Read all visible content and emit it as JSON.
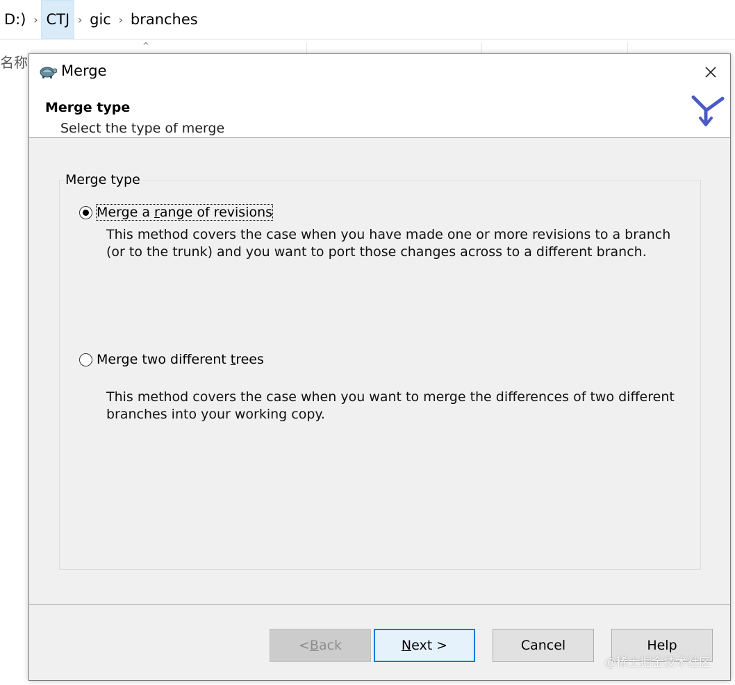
{
  "explorer": {
    "breadcrumb": [
      {
        "label": "D:)"
      },
      {
        "label": "CTJ"
      },
      {
        "label": "gic"
      },
      {
        "label": "branches"
      }
    ],
    "name_column": "名称"
  },
  "dialog": {
    "title": "Merge",
    "header_title": "Merge type",
    "header_subtitle": "Select the type of merge",
    "group_title": "Merge type",
    "options": [
      {
        "pre": "Merge a ",
        "mnemonic": "r",
        "post": "ange of revisions",
        "selected": true,
        "description": [
          "This method covers the case when you have made one or more revisions to a branch",
          "(or to the trunk) and you want to port those changes across to a different branch."
        ]
      },
      {
        "pre": "Merge two different ",
        "mnemonic": "t",
        "post": "rees",
        "selected": false,
        "description": [
          "This method covers the case when you want to merge the differences of two different",
          "branches into your working copy."
        ]
      }
    ],
    "buttons": {
      "back": {
        "pre": "< ",
        "mnemonic": "B",
        "post": "ack",
        "enabled": false
      },
      "next": {
        "pre": "",
        "mnemonic": "N",
        "post": "ext >",
        "enabled": true
      },
      "cancel": {
        "label": "Cancel"
      },
      "help": {
        "label": "Help"
      }
    },
    "icons": {
      "app": "tortoise-icon",
      "logo": "merge-icon",
      "close": "close-icon"
    },
    "colors": {
      "accent": "#0078d7",
      "logo": "#4a5bc4"
    }
  },
  "watermark": "@稀土掘金技术社区"
}
